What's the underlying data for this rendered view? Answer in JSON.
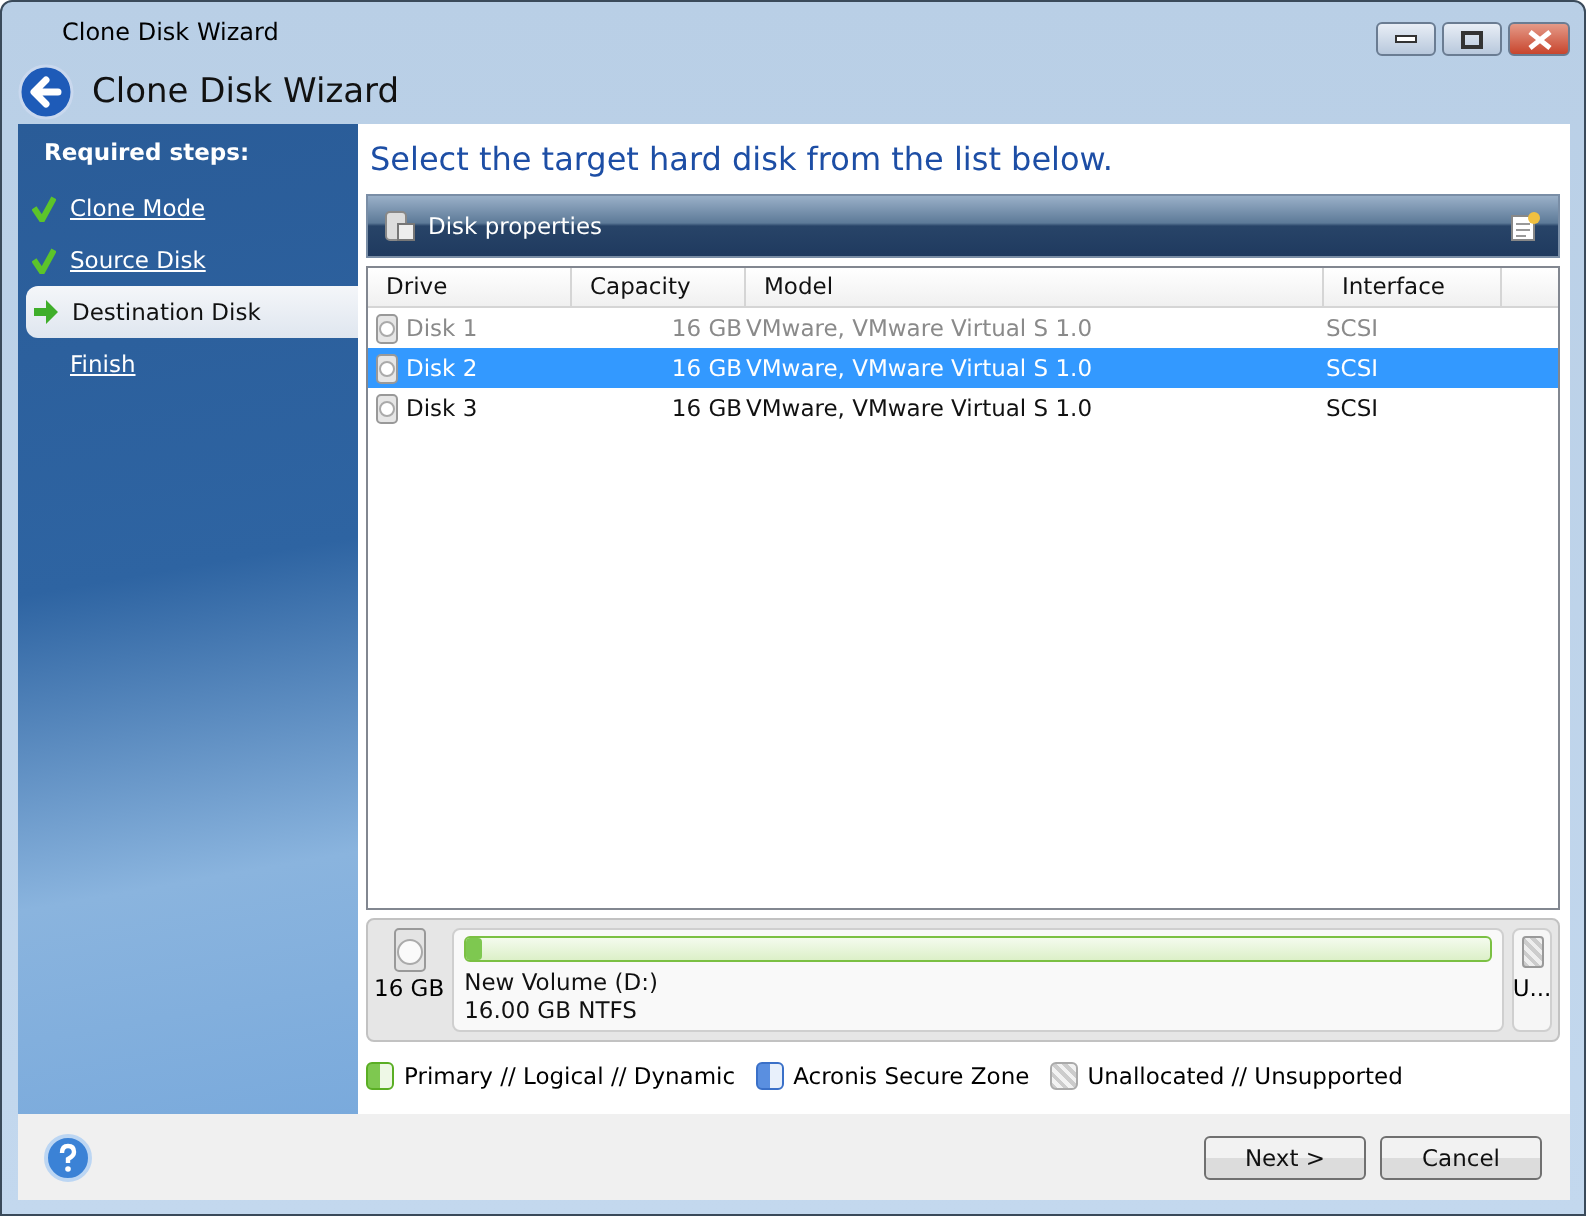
{
  "window": {
    "title": "Clone Disk Wizard"
  },
  "header": {
    "title": "Clone Disk Wizard"
  },
  "sidebar": {
    "heading": "Required steps:",
    "steps": [
      {
        "label": "Clone Mode",
        "kind": "done",
        "selected": false
      },
      {
        "label": "Source Disk",
        "kind": "done",
        "selected": false
      },
      {
        "label": "Destination Disk",
        "kind": "current",
        "selected": true
      },
      {
        "label": "Finish",
        "kind": "pending",
        "selected": false
      }
    ]
  },
  "instruction": "Select the target hard disk from the list below.",
  "toolbar": {
    "title": "Disk properties"
  },
  "table": {
    "columns": [
      "Drive",
      "Capacity",
      "Model",
      "Interface"
    ],
    "rows": [
      {
        "drive": "Disk 1",
        "capacity": "16 GB",
        "model": "VMware, VMware Virtual S 1.0",
        "interface": "SCSI",
        "disabled": true,
        "selected": false
      },
      {
        "drive": "Disk 2",
        "capacity": "16 GB",
        "model": "VMware, VMware Virtual S 1.0",
        "interface": "SCSI",
        "disabled": false,
        "selected": true
      },
      {
        "drive": "Disk 3",
        "capacity": "16 GB",
        "model": "VMware, VMware Virtual S 1.0",
        "interface": "SCSI",
        "disabled": false,
        "selected": false
      }
    ]
  },
  "disk_map": {
    "size": "16 GB",
    "partition": {
      "name": "New Volume (D:)",
      "details": "16.00 GB  NTFS",
      "level": 0.015
    },
    "unallocated": "U..."
  },
  "legend": [
    {
      "kind": "primary",
      "label": "Primary // Logical // Dynamic"
    },
    {
      "kind": "secure",
      "label": "Acronis Secure Zone"
    },
    {
      "kind": "unallocated",
      "label": "Unallocated // Unsupported"
    }
  ],
  "buttons": [
    {
      "label": "Next >"
    },
    {
      "label": "Cancel"
    }
  ]
}
